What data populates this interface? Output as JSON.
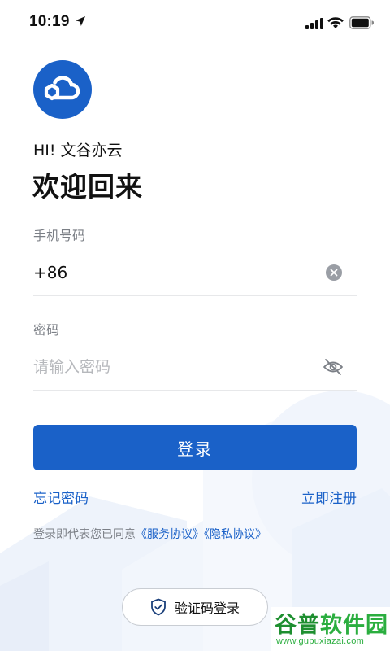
{
  "status_bar": {
    "time": "10:19",
    "icons": [
      "location-arrow-icon",
      "signal-icon",
      "wifi-icon",
      "battery-icon"
    ]
  },
  "brand": {
    "logo_icon": "cloud-hexagon-logo-icon",
    "greeting": "HI! 文谷亦云",
    "welcome": "欢迎回来"
  },
  "phone": {
    "label": "手机号码",
    "country_code": "+86",
    "value": "",
    "clear_icon": "clear-icon"
  },
  "password": {
    "label": "密码",
    "placeholder": "请输入密码",
    "value": "",
    "visibility_icon": "eye-off-icon"
  },
  "actions": {
    "login_label": "登录",
    "forgot_password": "忘记密码",
    "register": "立即注册"
  },
  "agreement": {
    "prefix": "登录即代表您已同意",
    "service_link": "《服务协议》",
    "privacy_link": "《隐私协议》"
  },
  "alt_login": {
    "label": "验证码登录",
    "icon": "shield-check-icon"
  },
  "watermark": {
    "brand_gu": "谷普",
    "brand_rest": "软件园",
    "url": "www.gupuxiazai.com"
  },
  "colors": {
    "accent": "#1a61c8",
    "muted_text": "#7b7f86",
    "watermark_green": "#2bae3f"
  }
}
